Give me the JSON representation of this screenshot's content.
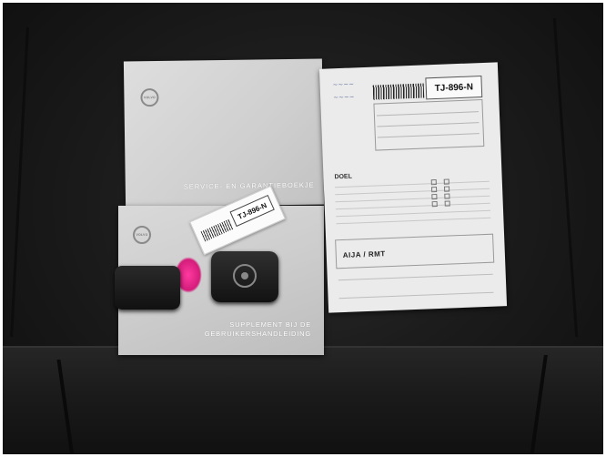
{
  "service_booklet": {
    "title": "SERVICE- EN GARANTIEBOEKJE",
    "logo_text": "VOLVO"
  },
  "supplement_booklet": {
    "line1": "SUPPLEMENT BIJ DE",
    "line2": "GEBRUIKERSHANDLEIDING",
    "logo_text": "VOLVO"
  },
  "document": {
    "plate": "TJ-896-N",
    "heading": "DOEL",
    "label": "AIJA / RMT"
  },
  "key_tag": {
    "plate": "TJ-896-N"
  }
}
